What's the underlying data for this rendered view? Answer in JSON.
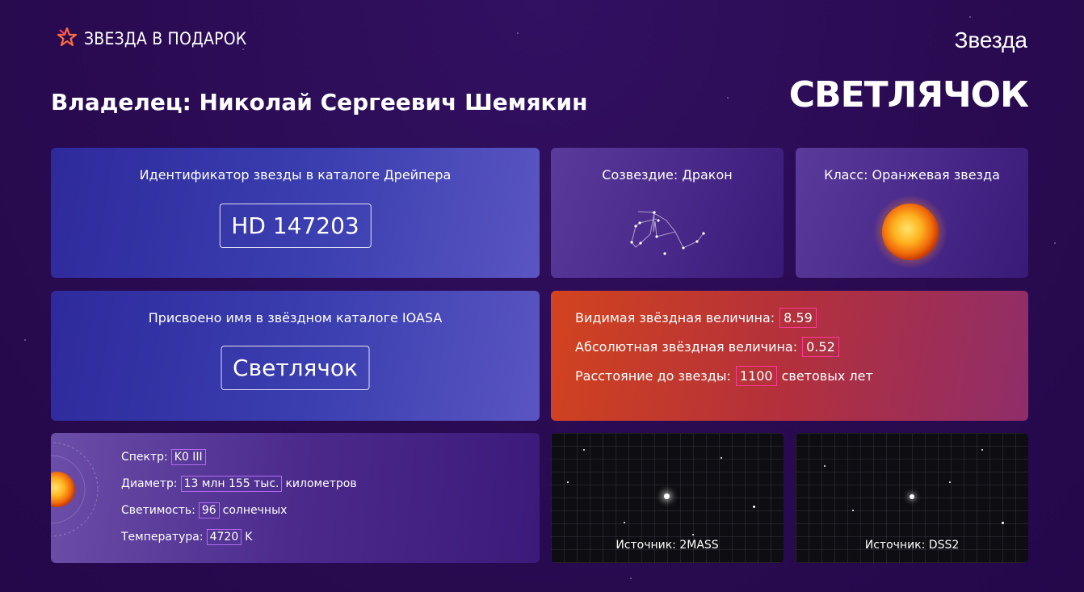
{
  "header": {
    "logo_text": "ЗВЕЗДА В ПОДАРОК",
    "star_label": "Звезда",
    "star_name_big": "СВЕТЛЯЧОК",
    "owner": "Владелец: Николай Сергеевич Шемякин"
  },
  "catalog_card": {
    "title": "Идентификатор звезды в каталоге Дрейпера",
    "value": "HD 147203"
  },
  "constellation_card": {
    "title": "Созвездие: Дракон"
  },
  "class_card": {
    "title": "Класс: Оранжевая звезда"
  },
  "ioasa_card": {
    "title": "Присвоено имя в звёздном каталоге IOASA",
    "value": "Светлячок"
  },
  "magnitude_card": {
    "visible_label": "Видимая звёздная величина:",
    "visible_value": "8.59",
    "absolute_label": "Абсолютная звёздная величина:",
    "absolute_value": "0.52",
    "distance_label": "Расстояние до звезды:",
    "distance_value": "1100",
    "distance_unit": "световых лет"
  },
  "spec_card": {
    "spectrum_label": "Спектр:",
    "spectrum_value": "K0 III",
    "diameter_label": "Диаметр:",
    "diameter_value": "13 млн 155 тыс.",
    "diameter_unit": "километров",
    "luminosity_label": "Светимость:",
    "luminosity_value": "96",
    "luminosity_unit": "солнечных",
    "temperature_label": "Температура:",
    "temperature_value": "4720",
    "temperature_unit": "K"
  },
  "sky_cards": [
    {
      "caption": "Источник: 2MASS"
    },
    {
      "caption": "Источник: DSS2"
    }
  ],
  "colors": {
    "background": "#2a0b52",
    "accent_pink": "#ff3a96",
    "accent_violet": "#b06cf0"
  }
}
